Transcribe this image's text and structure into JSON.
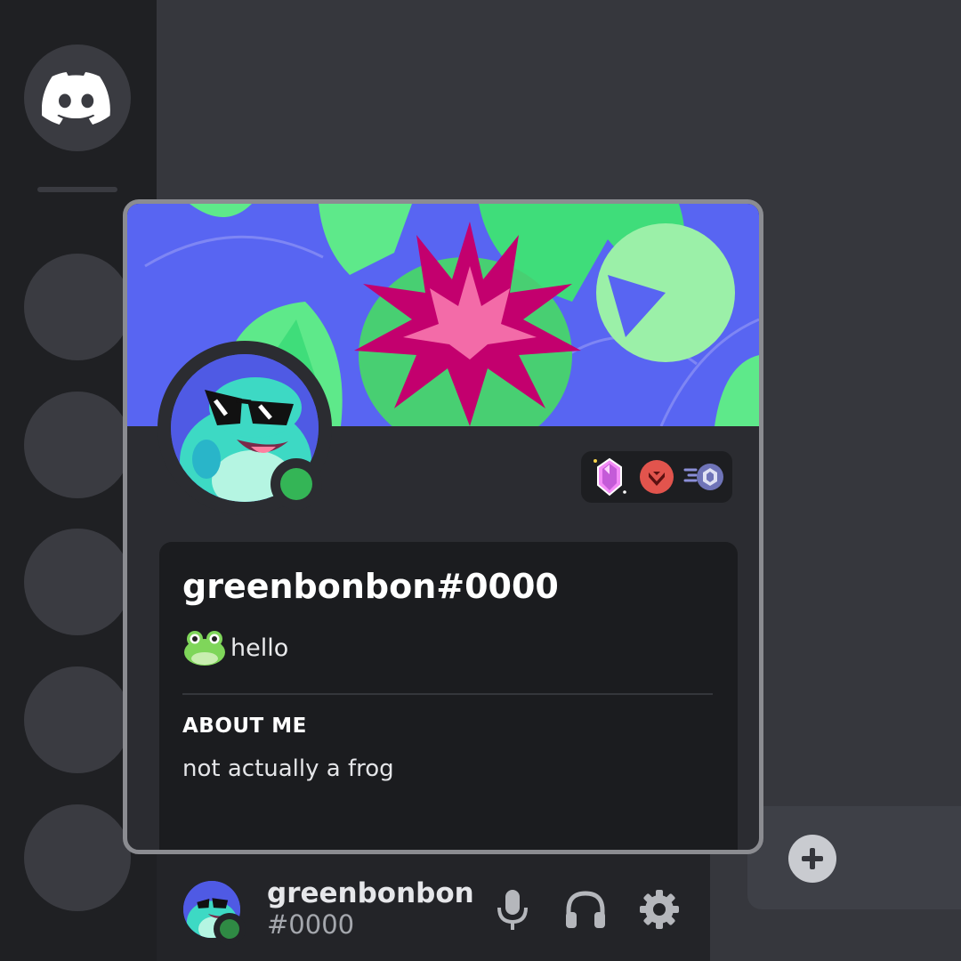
{
  "colors": {
    "background": "#36373d",
    "rail": "#1f2023",
    "popout_border": "#8b8c91",
    "banner_blue": "#5865f2",
    "online": "#34b556",
    "lily_pad": "#5ee98a",
    "flower_pink": "#e0197c"
  },
  "sidebar": {
    "home_icon": "discord-logo-icon",
    "servers": [
      "server-1",
      "server-2",
      "server-3",
      "server-4",
      "server-5"
    ]
  },
  "profile": {
    "username": "greenbonbon#0000",
    "custom_status": {
      "emoji": "frog-emoji-icon",
      "text": "hello"
    },
    "about_me_heading": "ABOUT ME",
    "about_me_text": "not actually a frog",
    "status": "online",
    "badges": [
      "nitro-gem-icon",
      "hypesquad-brilliance-icon",
      "server-boost-icon"
    ]
  },
  "user_panel": {
    "name": "greenbonbon",
    "tag": "#0000",
    "controls": [
      "microphone-icon",
      "headphones-icon",
      "settings-gear-icon"
    ]
  },
  "add_button_icon": "plus-icon"
}
